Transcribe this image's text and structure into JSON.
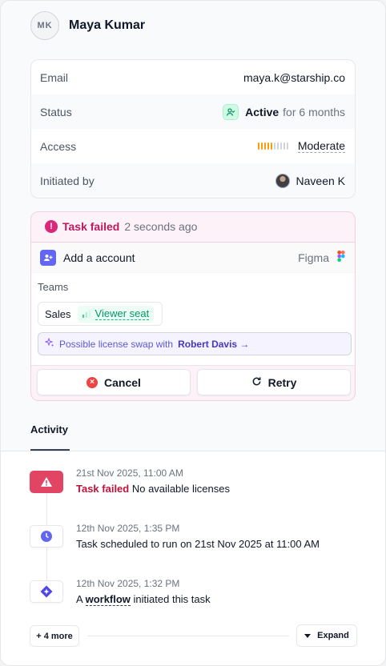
{
  "user": {
    "initials": "MK",
    "name": "Maya Kumar"
  },
  "details": {
    "email_label": "Email",
    "email_value": "maya.k@starship.co",
    "status_label": "Status",
    "status_value": "Active",
    "status_duration": "for 6 months",
    "access_label": "Access",
    "access_value": "Moderate",
    "access_level_fraction": 0.5,
    "initiated_label": "Initiated by",
    "initiated_value": "Naveen K"
  },
  "task": {
    "status": "Task failed",
    "time": "2 seconds ago",
    "action": "Add a account",
    "app": "Figma",
    "teams_label": "Teams",
    "team": "Sales",
    "seat": "Viewer seat",
    "suggestion_prefix": "Possible license swap with",
    "suggestion_name": "Robert Davis →",
    "cancel_label": "Cancel",
    "retry_label": "Retry"
  },
  "activity": {
    "tab_label": "Activity",
    "items": [
      {
        "time": "21st Nov 2025, 11:00 AM",
        "label": "Task failed",
        "text": " No available licenses"
      },
      {
        "time": "12th Nov 2025, 1:35 PM",
        "text": "Task scheduled to run on 21st Nov 2025 at 11:00 AM"
      },
      {
        "time": "12th Nov 2025, 1:32 PM",
        "prefix": "A ",
        "link": "workflow",
        "suffix": " initiated this task"
      }
    ],
    "more_label": "+ 4 more",
    "expand_label": "Expand"
  }
}
